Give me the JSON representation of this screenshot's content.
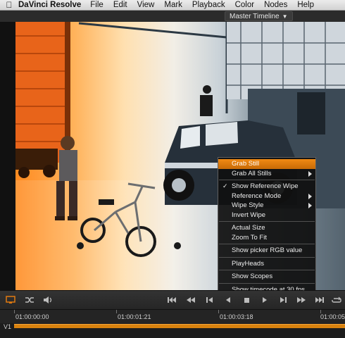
{
  "menubar": {
    "app_name": "DaVinci Resolve",
    "items": [
      "File",
      "Edit",
      "View",
      "Mark",
      "Playback",
      "Color",
      "Nodes",
      "Help"
    ]
  },
  "viewer": {
    "timeline_selector": "Master Timeline"
  },
  "context_menu": {
    "items": [
      {
        "label": "Grab Still",
        "highlighted": true
      },
      {
        "label": "Grab All Stills",
        "submenu": true
      },
      {
        "separator": true
      },
      {
        "label": "Show Reference Wipe",
        "checked": true
      },
      {
        "label": "Reference Mode",
        "submenu": true
      },
      {
        "label": "Wipe Style",
        "submenu": true
      },
      {
        "label": "Invert Wipe"
      },
      {
        "separator": true
      },
      {
        "label": "Actual Size"
      },
      {
        "label": "Zoom To Fit"
      },
      {
        "separator": true
      },
      {
        "label": "Show picker RGB value"
      },
      {
        "separator": true
      },
      {
        "label": "PlayHeads"
      },
      {
        "separator": true
      },
      {
        "label": "Show Scopes"
      },
      {
        "separator": true
      },
      {
        "label": "Show timecode at 30 fps"
      }
    ]
  },
  "ruler": {
    "timecodes": [
      "01:00:00:00",
      "01:00:01:21",
      "01:00:03:18",
      "01:00:05"
    ]
  },
  "track": {
    "label": "V1"
  },
  "colors": {
    "accent": "#e07a10",
    "clip": "#d9820e",
    "background": "#1e1e1e"
  }
}
